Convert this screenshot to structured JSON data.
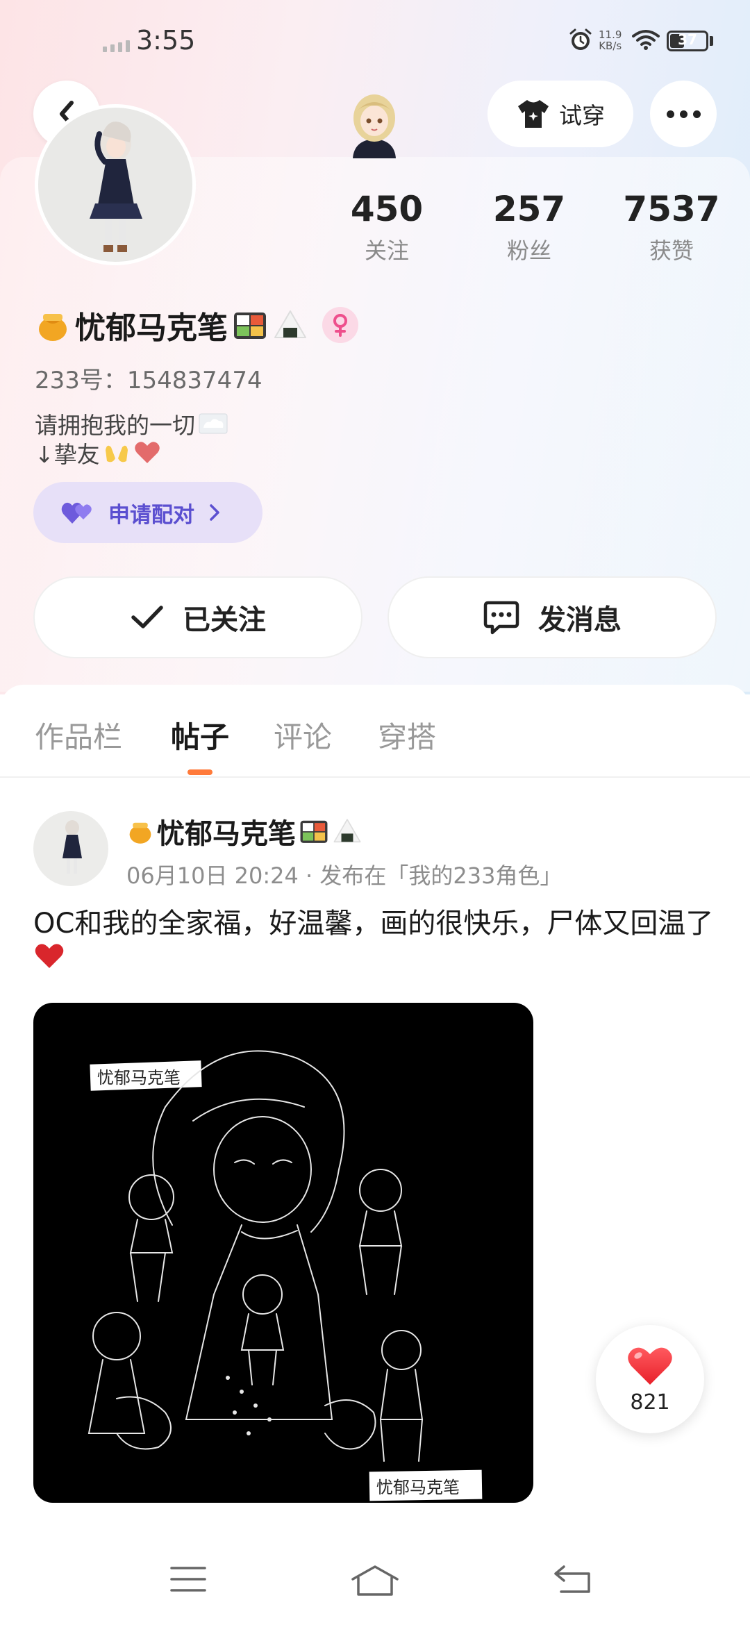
{
  "status_bar": {
    "time": "3:55",
    "net_speed_value": "11.9",
    "net_speed_unit": "KB/s",
    "battery": "37",
    "battery_level": 0.37
  },
  "header": {
    "tryon_label": "试穿"
  },
  "profile": {
    "name": "忧郁马克笔",
    "uid": "233号：154837474",
    "bio_line1": "请拥抱我的一切",
    "bio_line2": "↓挚友",
    "pair_label": "申请配对",
    "stats": [
      {
        "value": "450",
        "label": "关注"
      },
      {
        "value": "257",
        "label": "粉丝"
      },
      {
        "value": "7537",
        "label": "获赞"
      }
    ]
  },
  "actions": {
    "followed_label": "已关注",
    "message_label": "发消息"
  },
  "tabs": [
    {
      "label": "作品栏",
      "active": false
    },
    {
      "label": "帖子",
      "active": true
    },
    {
      "label": "评论",
      "active": false
    },
    {
      "label": "穿搭",
      "active": false
    }
  ],
  "post": {
    "author": "忧郁马克笔",
    "meta": "06月10日 20:24 · 发布在「我的233角色」",
    "text": "OC和我的全家福，好温馨，画的很快乐，尸体又回温了",
    "image_signature": "忧郁马克笔",
    "likes": "821"
  },
  "colors": {
    "accent": "#ff7a3a",
    "pair_bg": "#e7e0f8",
    "pair_text": "#5b4fd0",
    "heart": "#f0383c"
  },
  "icons": [
    "back-icon",
    "tshirt-icon",
    "more-icon",
    "purple-heart-icon",
    "check-icon",
    "chat-icon",
    "heart-icon",
    "menu-icon",
    "home-icon",
    "return-icon"
  ]
}
